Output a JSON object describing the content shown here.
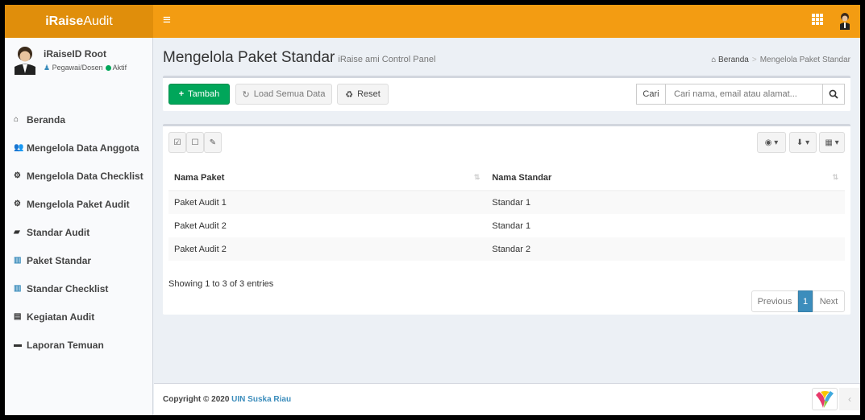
{
  "brand": {
    "bold": "iRaise",
    "rest": "Audit"
  },
  "user": {
    "name": "iRaiseID Root",
    "role": "Pegawai/Dosen",
    "status": "Aktif"
  },
  "sidebar": {
    "items": [
      {
        "icon": "home-icon",
        "label": "Beranda"
      },
      {
        "icon": "users-icon",
        "label": "Mengelola Data Anggota"
      },
      {
        "icon": "cogs-icon",
        "label": "Mengelola Data Checklist"
      },
      {
        "icon": "cogs-icon",
        "label": "Mengelola Paket Audit"
      },
      {
        "icon": "book-icon",
        "label": "Standar Audit"
      },
      {
        "icon": "bar-chart-icon",
        "label": "Paket Standar"
      },
      {
        "icon": "bar-chart-icon",
        "label": "Standar Checklist"
      },
      {
        "icon": "id-card-icon",
        "label": "Kegiatan Audit"
      },
      {
        "icon": "folder-icon",
        "label": "Laporan Temuan"
      }
    ]
  },
  "page": {
    "title": "Mengelola Paket Standar",
    "subtitle": "iRaise ami Control Panel"
  },
  "breadcrumb": {
    "home": "Beranda",
    "current": "Mengelola Paket Standar"
  },
  "toolbar": {
    "add": "Tambah",
    "load": "Load Semua Data",
    "reset": "Reset"
  },
  "search": {
    "label": "Cari",
    "placeholder": "Cari nama, email atau alamat..."
  },
  "table": {
    "columns": [
      "Nama Paket",
      "Nama Standar"
    ],
    "rows": [
      [
        "Paket Audit 1",
        "Standar 1"
      ],
      [
        "Paket Audit 2",
        "Standar 1"
      ],
      [
        "Paket Audit 2",
        "Standar 2"
      ]
    ]
  },
  "info": "Showing 1 to 3 of 3 entries",
  "pagination": {
    "prev": "Previous",
    "page": "1",
    "next": "Next"
  },
  "footer": {
    "prefix": "Copyright © 2020",
    "link": "UIN Suska Riau"
  },
  "colors": {
    "topbar": "#f39c12",
    "logo_bg": "#e08e0b",
    "primary": "#3c8dbc",
    "success": "#00a65a"
  }
}
